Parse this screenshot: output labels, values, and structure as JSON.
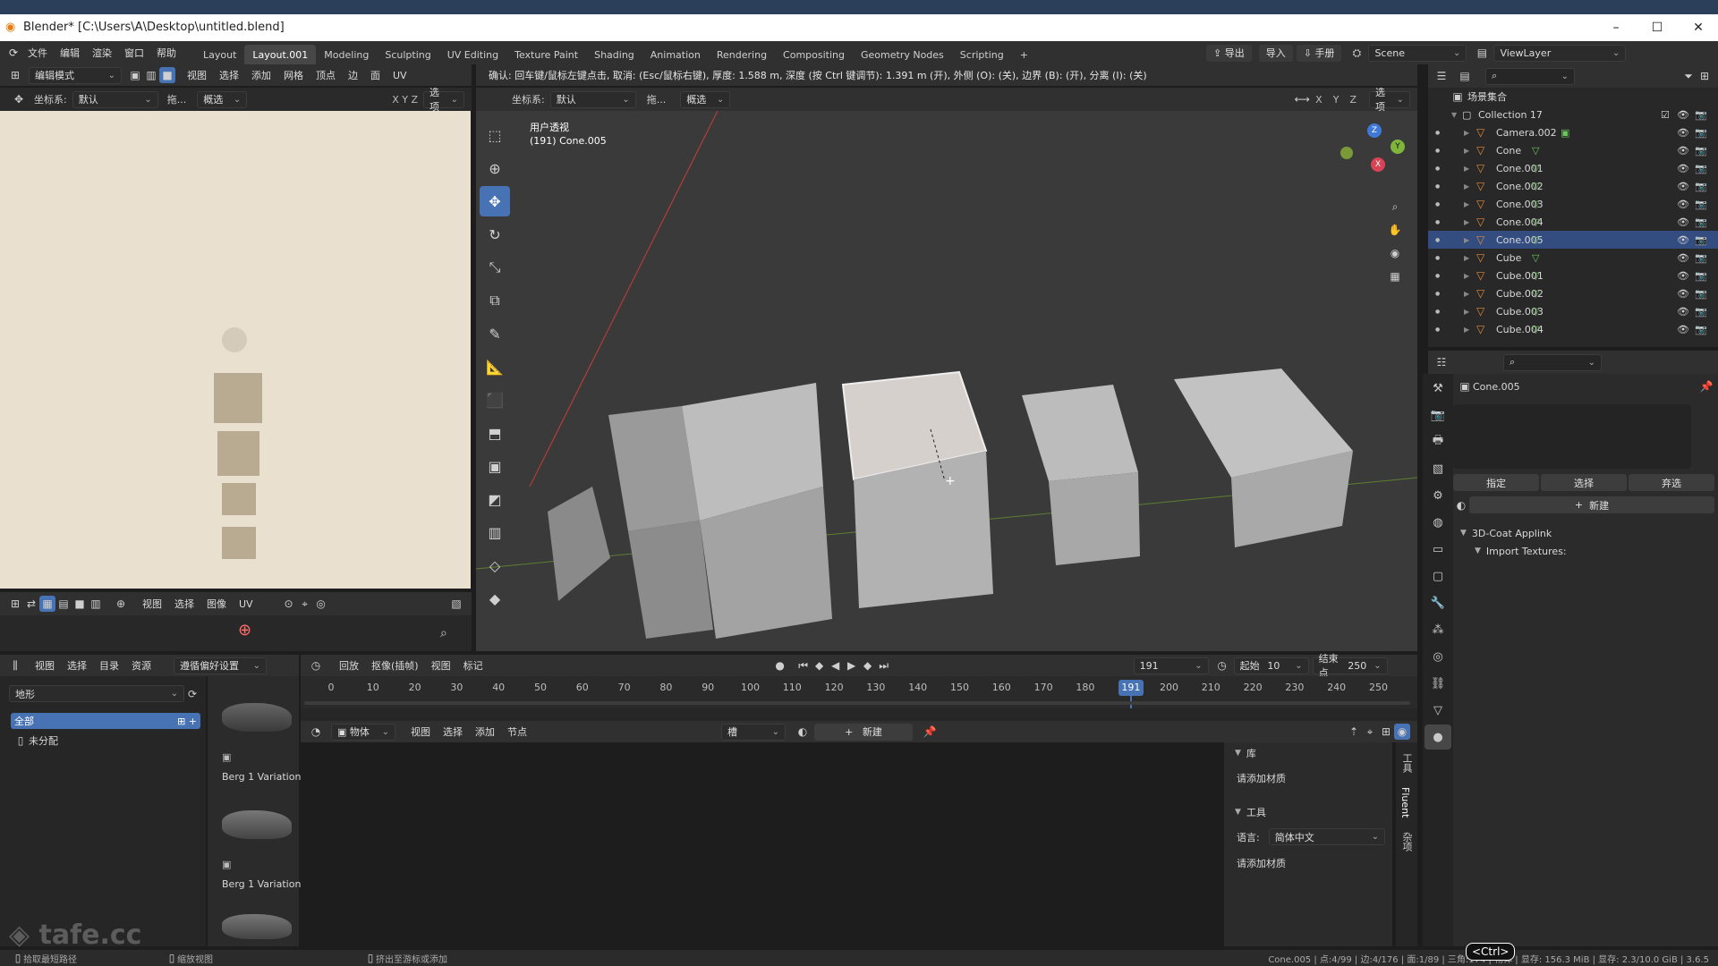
{
  "window": {
    "title": "Blender* [C:\\Users\\A\\Desktop\\untitled.blend]",
    "min": "–",
    "max": "☐",
    "close": "✕"
  },
  "menu": [
    "文件",
    "编辑",
    "渲染",
    "窗口",
    "帮助"
  ],
  "workspaces": [
    "Layout",
    "Layout.001",
    "Modeling",
    "Sculpting",
    "UV Editing",
    "Texture Paint",
    "Shading",
    "Animation",
    "Rendering",
    "Compositing",
    "Geometry Nodes",
    "Scripting"
  ],
  "workspace_active_index": 1,
  "topbar_right": {
    "export": "导出",
    "import": "导入",
    "manual": "手册",
    "scene": "Scene",
    "viewlayer": "ViewLayer"
  },
  "image_editor": {
    "mode": "编辑模式",
    "menus": [
      "视图",
      "选择",
      "添加",
      "网格",
      "顶点",
      "边",
      "面",
      "UV"
    ],
    "coord_label": "坐标系:",
    "coord_value": "默认",
    "drag_label": "拖...",
    "select_value": "概选",
    "options": "选项",
    "footer_menus": [
      "视图",
      "选择",
      "图像",
      "UV"
    ]
  },
  "viewport": {
    "status_msg": "确认: 回车键/鼠标左键点击, 取消: (Esc/鼠标右键), 厚度: 1.588 m, 深度 (按 Ctrl 键调节): 1.391 m (开), 外侧 (O): (关), 边界 (B): (开), 分离 (I): (关)",
    "coord_label": "坐标系:",
    "coord_value": "默认",
    "drag_label": "拖...",
    "select_value": "概选",
    "options": "选项",
    "view_name": "用户透视",
    "object_info": "(191) Cone.005",
    "axes": [
      "X",
      "Y",
      "Z"
    ],
    "gizmo": {
      "z": "Z",
      "y": "Y",
      "x": "X"
    }
  },
  "outliner": {
    "root": "场景集合",
    "collection": "Collection 17",
    "items": [
      {
        "name": "Camera.002",
        "kind": "camera",
        "selected": false
      },
      {
        "name": "Cone",
        "kind": "mesh",
        "selected": false
      },
      {
        "name": "Cone.001",
        "kind": "mesh",
        "selected": false
      },
      {
        "name": "Cone.002",
        "kind": "mesh",
        "selected": false
      },
      {
        "name": "Cone.003",
        "kind": "mesh",
        "selected": false
      },
      {
        "name": "Cone.004",
        "kind": "mesh",
        "selected": false
      },
      {
        "name": "Cone.005",
        "kind": "mesh",
        "selected": true
      },
      {
        "name": "Cube",
        "kind": "mesh",
        "selected": false
      },
      {
        "name": "Cube.001",
        "kind": "mesh",
        "selected": false
      },
      {
        "name": "Cube.002",
        "kind": "mesh",
        "selected": false
      },
      {
        "name": "Cube.003",
        "kind": "mesh",
        "selected": false
      },
      {
        "name": "Cube.004",
        "kind": "mesh",
        "selected": false
      }
    ]
  },
  "properties": {
    "object_name": "Cone.005",
    "assign": "指定",
    "select": "选择",
    "deselect": "弃选",
    "new": "新建",
    "panel_3dcoat": "3D-Coat Applink",
    "panel_import": "Import Textures:"
  },
  "timeline": {
    "menus": [
      "回放",
      "抠像(插帧)",
      "视图",
      "标记"
    ],
    "current_frame": "191",
    "start_label": "起始",
    "start": "10",
    "end_label": "结束点",
    "end": "250",
    "ticks": [
      "0",
      "10",
      "20",
      "30",
      "40",
      "50",
      "60",
      "70",
      "80",
      "90",
      "100",
      "110",
      "120",
      "130",
      "140",
      "150",
      "160",
      "170",
      "180",
      "190",
      "200",
      "210",
      "220",
      "230",
      "240",
      "250"
    ]
  },
  "asset_browser": {
    "menus": [
      "视图",
      "选择",
      "目录",
      "资源"
    ],
    "library": "遵循偏好设置",
    "category": "地形",
    "all": "全部",
    "unassigned": "未分配",
    "assets": [
      "Berg 1 Variation",
      "Berg 1 Variation"
    ]
  },
  "shader_editor": {
    "object_dd": "物体",
    "menus": [
      "视图",
      "选择",
      "添加",
      "节点"
    ],
    "slot": "槽",
    "new": "新建",
    "panel_lib": "库",
    "lib_hint": "请添加材质",
    "panel_tools": "工具",
    "lang_label": "语言:",
    "lang_value": "简体中文",
    "tools_hint": "请添加材质",
    "side_tabs": [
      "工具",
      "Fluent",
      "杂项"
    ]
  },
  "statusbar": {
    "left1": "拾取最短路径",
    "left2": "缩放视图",
    "left3": "挤出至游标或添加",
    "right": "Cone.005 | 点:4/99 | 边:4/176 | 面:1/89 | 三角:174 | 物体 | 显存: 156.3 MiB | 显存: 2.3/10.0 GiB | 3.6.5",
    "ctrl": "<Ctrl>"
  },
  "watermark": "tafe.cc",
  "colors": {
    "accent": "#4772b3",
    "selected_row": "#334d80",
    "current_frame": "#4772b3",
    "mesh_icon": "#6bc45e",
    "object_icon": "#e38b3a"
  }
}
